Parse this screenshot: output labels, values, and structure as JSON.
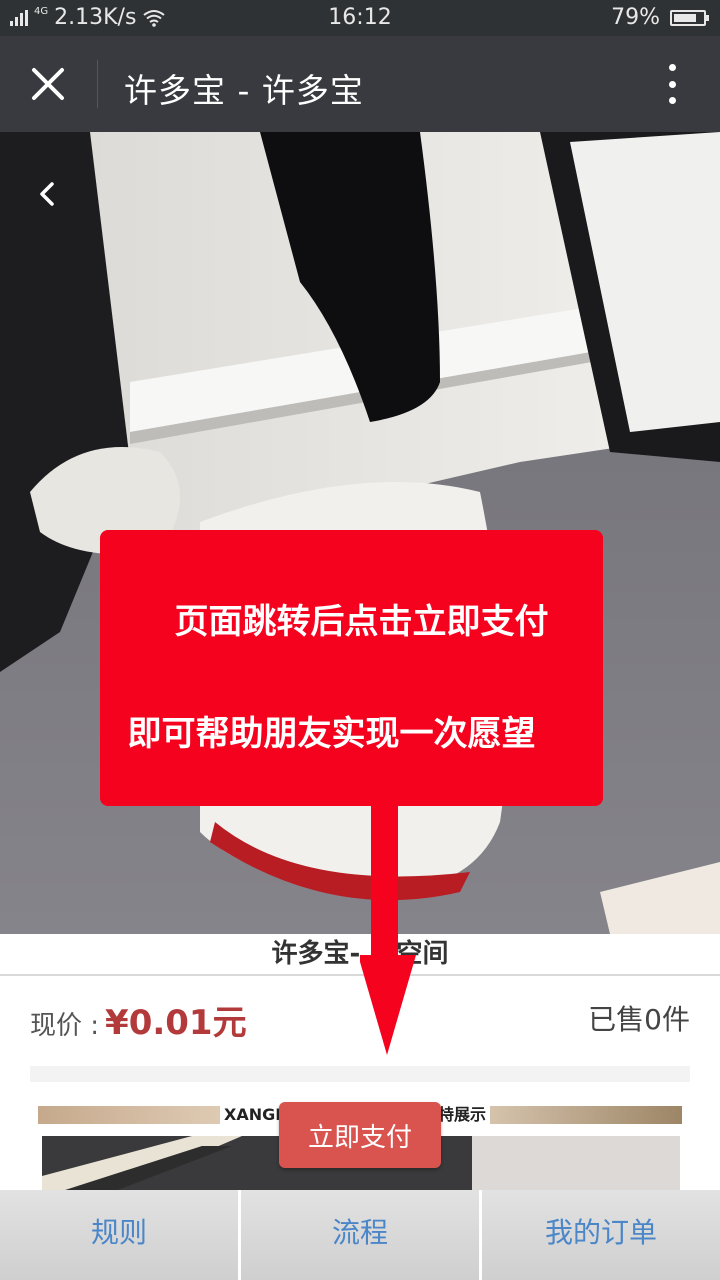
{
  "status_bar": {
    "network_type": "4G",
    "speed": "2.13K/s",
    "time": "16:12",
    "battery_percent": "79%",
    "battery_level": 0.79,
    "icons": [
      "signal-icon",
      "wifi-icon",
      "battery-icon"
    ]
  },
  "title_bar": {
    "title": "许多宝 - 许多宝",
    "icons": [
      "close-icon",
      "more-vertical-icon"
    ]
  },
  "hero": {
    "icons": [
      "back-chevron-icon"
    ]
  },
  "callout": {
    "line1": "页面跳转后点击立即支付",
    "line2": "即可帮助朋友实现一次愿望",
    "color": "#f5021f"
  },
  "product": {
    "name": "许多宝-    空间",
    "price_label": "现价 : ",
    "price_value": "¥0.01元",
    "sold": "已售0件",
    "detail_banner_left": "XANGE",
    "detail_banner_right": "特展示"
  },
  "pay_button": {
    "label": "立即支付",
    "color": "#d9534f"
  },
  "bottom_nav": {
    "items": [
      {
        "label": "规则"
      },
      {
        "label": "流程"
      },
      {
        "label": "我的订单"
      }
    ],
    "link_color": "#4b86c8"
  }
}
